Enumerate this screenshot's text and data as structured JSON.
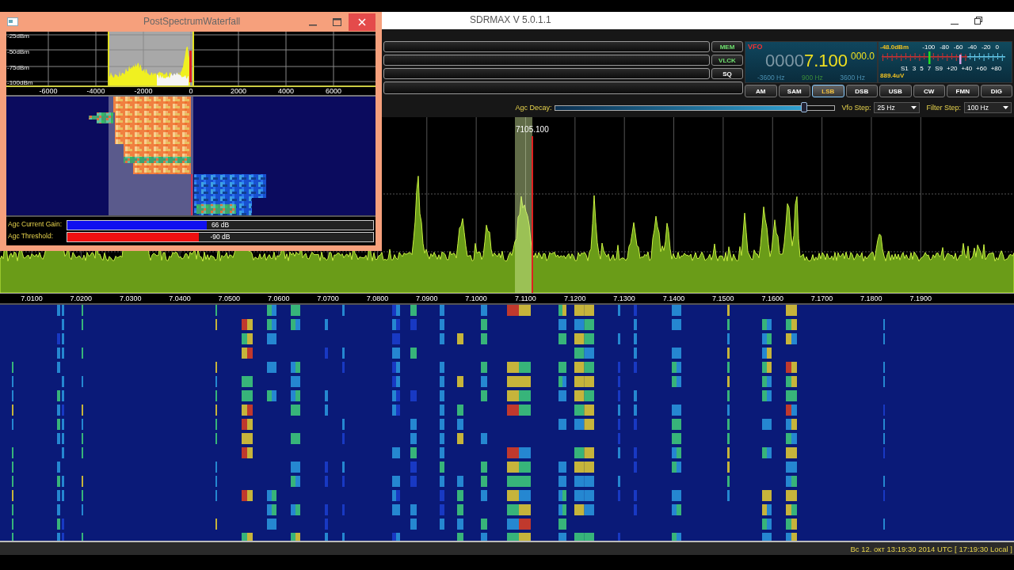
{
  "main_window": {
    "title": "SDRMAX V 5.0.1.1"
  },
  "side_buttons": [
    {
      "label": "MEM",
      "on": true
    },
    {
      "label": "VLCK",
      "on": true
    },
    {
      "label": "SQ",
      "on": false
    }
  ],
  "vfo": {
    "label": "VFO",
    "frequency_dim": "0000",
    "frequency": "7.100",
    "fine": "000.0",
    "low": "-3600 Hz",
    "center": "900 Hz",
    "high": "3600 Hz"
  },
  "s_meter": {
    "reading": "-48.0dBm",
    "dbm_scale": [
      "-100",
      "-80",
      "-60",
      "-40",
      "-20",
      "0"
    ],
    "s_scale": [
      "S1",
      "3",
      "5",
      "7",
      "S9",
      "+20",
      "+40",
      "+60",
      "+80"
    ],
    "voltage": "889.4uV"
  },
  "modes": [
    {
      "label": "AM",
      "selected": false
    },
    {
      "label": "SAM",
      "selected": false
    },
    {
      "label": "LSB",
      "selected": true
    },
    {
      "label": "DSB",
      "selected": false
    },
    {
      "label": "USB",
      "selected": false
    },
    {
      "label": "CW",
      "selected": false
    },
    {
      "label": "FMN",
      "selected": false
    },
    {
      "label": "DIG",
      "selected": false
    }
  ],
  "agc_decay": {
    "label": "Agc Decay:",
    "level": 0.89
  },
  "vfo_step": {
    "label": "Vfo Step:",
    "value": "25 Hz"
  },
  "filter_step": {
    "label": "Filter Step:",
    "value": "100 Hz"
  },
  "spectrum": {
    "marker": "7105.100",
    "frequency_labels": [
      "7.0100",
      "7.0200",
      "7.0300",
      "7.0400",
      "7.0500",
      "7.0600",
      "7.0700",
      "7.0800",
      "7.0900",
      "7.1000",
      "7.1100",
      "7.1200",
      "7.1300",
      "7.1400",
      "7.1500",
      "7.1600",
      "7.1700",
      "7.1800",
      "7.1900"
    ]
  },
  "status_bar": {
    "text": "Вс 12. окт 13:19:30 2014 UTC [ 17:19:30 Local ]"
  },
  "popup": {
    "title": "PostSpectrumWaterfall",
    "db_labels": [
      "-25dBm",
      "-50dBm",
      "-75dBm",
      "-100dBm"
    ],
    "hz_labels": [
      "-6000",
      "-4000",
      "-2000",
      "0",
      "2000",
      "4000",
      "6000"
    ],
    "agc_gain": {
      "label": "Agc Current Gain:",
      "level": 0.455,
      "reading": "66 dB"
    },
    "agc_threshold": {
      "label": "Agc Threshold:",
      "level": 0.43,
      "reading": "-90 dB"
    }
  }
}
